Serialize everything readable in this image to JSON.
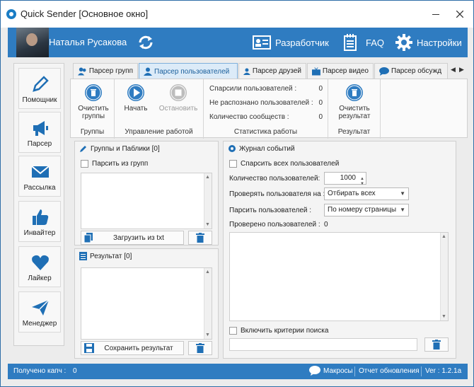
{
  "window": {
    "title": "Quick Sender [Основное окно]"
  },
  "header": {
    "user_name": "Наталья Русакова",
    "developer_label": "Разработчик",
    "faq_label": "FAQ",
    "settings_label": "Настройки"
  },
  "nav": {
    "items": [
      {
        "label": "Помощник",
        "icon": "pencil-icon"
      },
      {
        "label": "Парсер",
        "icon": "megaphone-icon"
      },
      {
        "label": "Рассылка",
        "icon": "envelope-icon"
      },
      {
        "label": "Инвайтер",
        "icon": "thumbs-up-icon"
      },
      {
        "label": "Лайкер",
        "icon": "heart-icon"
      },
      {
        "label": "Менеджер",
        "icon": "paper-plane-icon"
      }
    ]
  },
  "tabs": [
    {
      "label": "Парсер групп"
    },
    {
      "label": "Парсер пользователей",
      "active": true
    },
    {
      "label": "Парсер друзей"
    },
    {
      "label": "Парсер видео"
    },
    {
      "label": "Парсер обсужд"
    }
  ],
  "ribbon": {
    "groups_title": "Группы",
    "clear_groups": "Очистить группы",
    "control_title": "Управление работой",
    "start": "Начать",
    "stop": "Остановить",
    "stats_title": "Статистика работы",
    "stats": [
      {
        "label": "Спарсили пользователей :",
        "value": "0"
      },
      {
        "label": "Не распознано пользователей :",
        "value": "0"
      },
      {
        "label": "Количество сообществ :",
        "value": "0"
      }
    ],
    "result_title": "Результат",
    "clear_result": "Очистить результат"
  },
  "groups_panel": {
    "title": "Группы и Паблики [0]",
    "parse_from_groups": "Парсить из групп",
    "load_txt": "Загрузить из txt"
  },
  "result_panel": {
    "title": "Результат [0]",
    "save_result": "Сохранить результат"
  },
  "log_panel": {
    "title": "Журнал событий",
    "parse_all_users": "Спарсить всех пользователей",
    "user_count_label": "Количество пользователей:",
    "user_count_value": "1000",
    "check_users_label": "Проверять пользователя на :",
    "check_users_value": "Отбирать всех",
    "parse_users_label": "Парсить пользователей :",
    "parse_users_value": "По номеру страницы",
    "checked_users_label": "Проверено пользователей :",
    "checked_users_value": "0",
    "enable_search_criteria": "Включить критерии поиска"
  },
  "status": {
    "captcha_label": "Получено капч :",
    "captcha_value": "0",
    "macros": "Макросы",
    "update_report": "Отчет обновления",
    "version": "Ver : 1.2.1a"
  },
  "colors": {
    "accent": "#2f7cc1",
    "tab_active": "#dcebf8"
  }
}
